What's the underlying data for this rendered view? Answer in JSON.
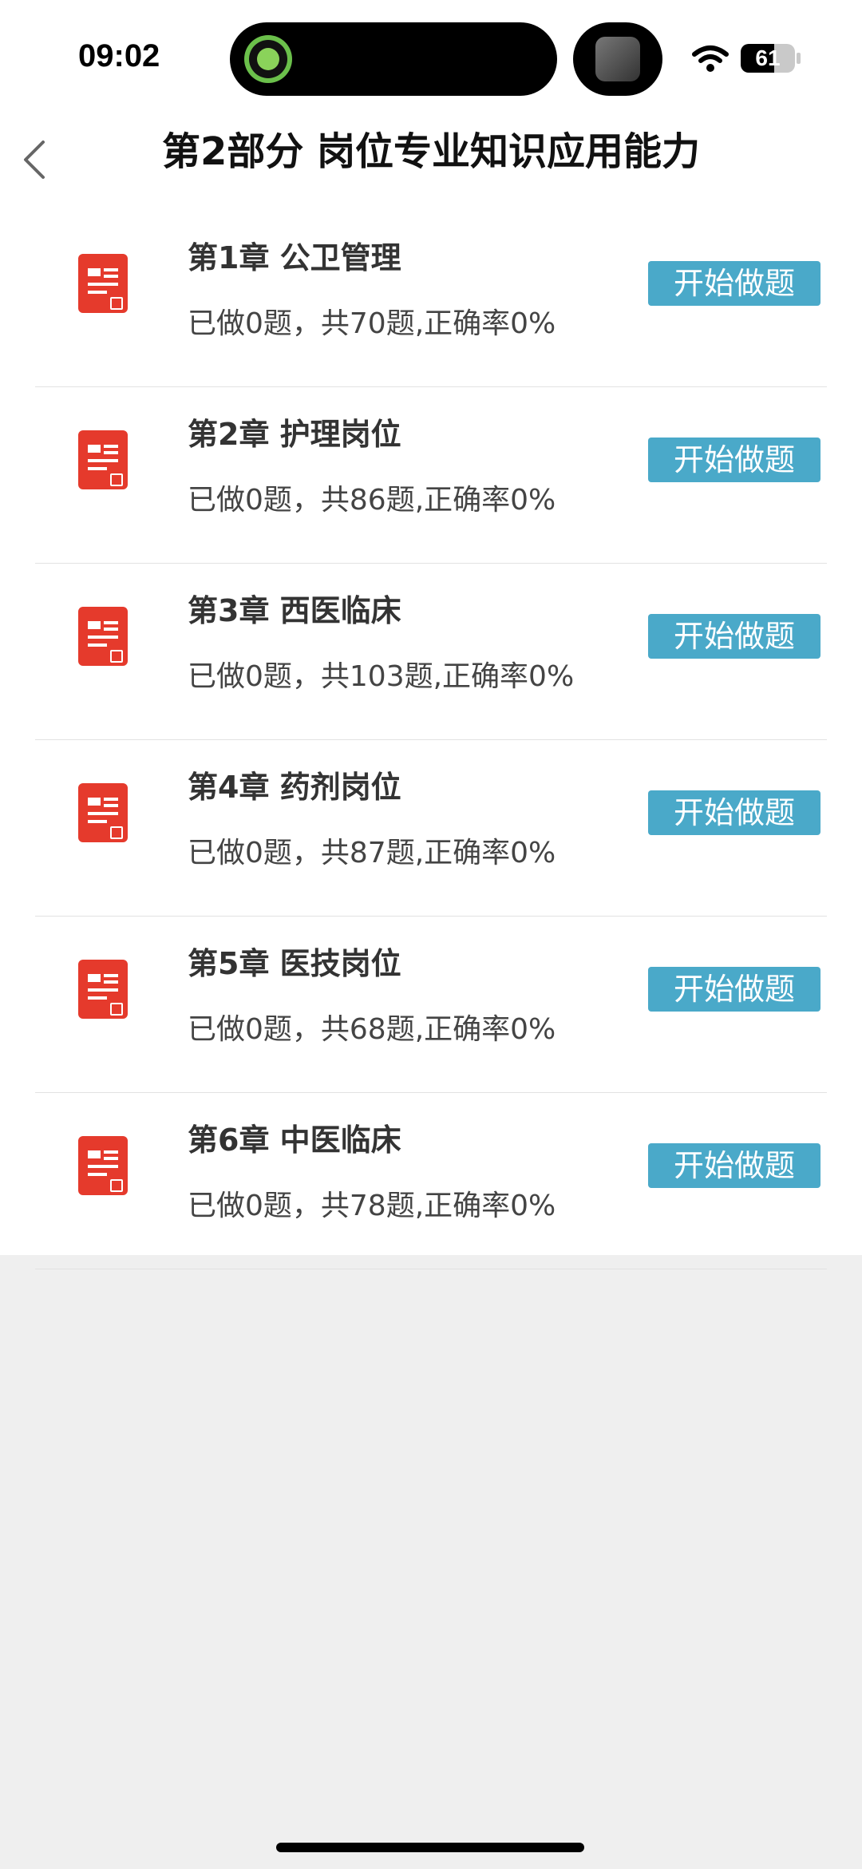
{
  "status_bar": {
    "time": "09:02",
    "battery": "61"
  },
  "header": {
    "title": "第2部分 岗位专业知识应用能力"
  },
  "chapters": [
    {
      "title": "第1章 公卫管理",
      "stats": "已做0题，共70题,正确率0%",
      "button": "开始做题"
    },
    {
      "title": "第2章 护理岗位",
      "stats": "已做0题，共86题,正确率0%",
      "button": "开始做题"
    },
    {
      "title": "第3章 西医临床",
      "stats": "已做0题，共103题,正确率0%",
      "button": "开始做题"
    },
    {
      "title": "第4章 药剂岗位",
      "stats": "已做0题，共87题,正确率0%",
      "button": "开始做题"
    },
    {
      "title": "第5章 医技岗位",
      "stats": "已做0题，共68题,正确率0%",
      "button": "开始做题"
    },
    {
      "title": "第6章 中医临床",
      "stats": "已做0题，共78题,正确率0%",
      "button": "开始做题"
    }
  ],
  "colors": {
    "accent": "#4aa9c9",
    "icon_red": "#e53a2c"
  },
  "icons": {
    "back": "chevron-left-icon",
    "chapter": "document-icon"
  }
}
